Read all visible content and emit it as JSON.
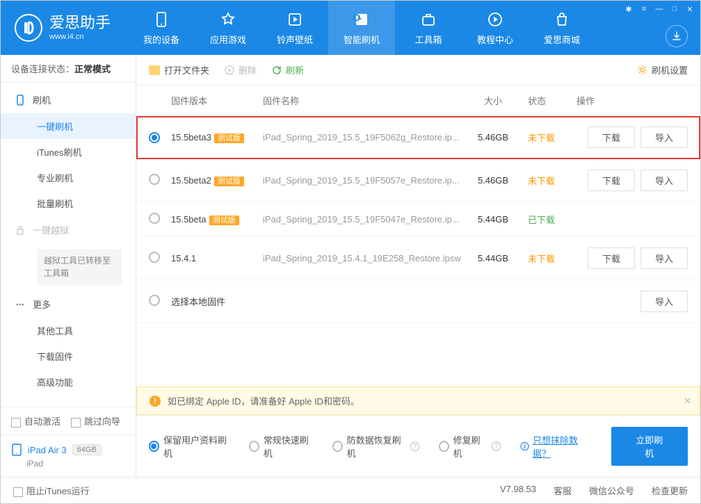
{
  "header": {
    "app_name": "爱思助手",
    "app_url": "www.i4.cn",
    "tabs": [
      "我的设备",
      "应用游戏",
      "铃声壁纸",
      "智能刷机",
      "工具箱",
      "教程中心",
      "爱思商城"
    ],
    "active_tab": 3
  },
  "sidebar": {
    "conn_label": "设备连接状态：",
    "conn_status": "正常模式",
    "groups": {
      "flash": {
        "title": "刷机",
        "items": [
          "一键刷机",
          "iTunes刷机",
          "专业刷机",
          "批量刷机"
        ],
        "active": 0
      },
      "jailbreak": {
        "title": "一键越狱",
        "note": "越狱工具已转移至工具箱"
      },
      "more": {
        "title": "更多",
        "items": [
          "其他工具",
          "下载固件",
          "高级功能"
        ]
      }
    },
    "auto_activate": "自动激活",
    "skip_guide": "跳过向导",
    "device_name": "iPad Air 3",
    "device_storage": "64GB",
    "device_type": "iPad"
  },
  "toolbar": {
    "open_folder": "打开文件夹",
    "delete": "删除",
    "refresh": "刷新",
    "settings": "刷机设置"
  },
  "table": {
    "headers": {
      "version": "固件版本",
      "name": "固件名称",
      "size": "大小",
      "status": "状态",
      "ops": "操作"
    },
    "rows": [
      {
        "version": "15.5beta3",
        "beta": "测试版",
        "name": "iPad_Spring_2019_15.5_19F5062g_Restore.ip...",
        "size": "5.46GB",
        "status": "未下载",
        "status_class": "pending",
        "selected": true,
        "highlighted": true,
        "download": true,
        "import": true
      },
      {
        "version": "15.5beta2",
        "beta": "测试版",
        "name": "iPad_Spring_2019_15.5_19F5057e_Restore.ip...",
        "size": "5.46GB",
        "status": "未下载",
        "status_class": "pending",
        "selected": false,
        "download": true,
        "import": true
      },
      {
        "version": "15.5beta",
        "beta": "测试版",
        "name": "iPad_Spring_2019_15.5_19F5047e_Restore.ip...",
        "size": "5.44GB",
        "status": "已下载",
        "status_class": "done",
        "selected": false,
        "download": false,
        "import": false
      },
      {
        "version": "15.4.1",
        "beta": "",
        "name": "iPad_Spring_2019_15.4.1_19E258_Restore.ipsw",
        "size": "5.44GB",
        "status": "未下载",
        "status_class": "pending",
        "selected": false,
        "download": true,
        "import": true
      },
      {
        "version": "选择本地固件",
        "beta": "",
        "name": "",
        "size": "",
        "status": "",
        "status_class": "",
        "selected": false,
        "download": false,
        "import": true
      }
    ],
    "btn_download": "下载",
    "btn_import": "导入"
  },
  "notice": "如已绑定 Apple ID，请准备好 Apple ID和密码。",
  "actionbar": {
    "options": [
      "保留用户资料刷机",
      "常规快速刷机",
      "防数据恢复刷机",
      "修复刷机"
    ],
    "selected": 0,
    "erase_link": "只想抹除数据？",
    "flash_btn": "立即刷机"
  },
  "statusbar": {
    "block_itunes": "阻止iTunes运行",
    "version": "V7.98.53",
    "support": "客服",
    "wechat": "微信公众号",
    "update": "检查更新"
  }
}
